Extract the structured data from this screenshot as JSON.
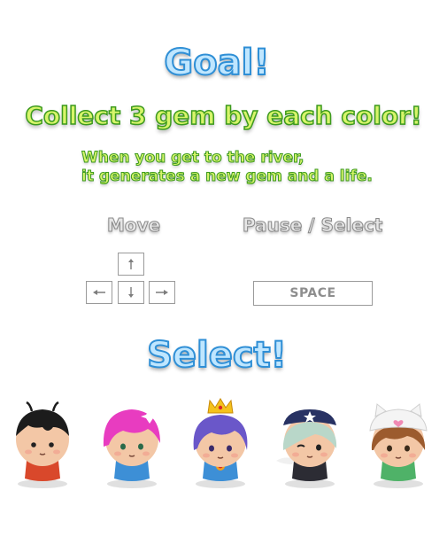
{
  "goal": {
    "title": "Goal!",
    "subtitle": "Collect 3 gem by each color!",
    "note_line1": "When you get to the river,",
    "note_line2": "it generates a new gem and a life."
  },
  "controls": {
    "move_label": "Move",
    "pause_label": "Pause / Select",
    "space_key": "SPACE",
    "arrow_icons": [
      "arrow-up-icon",
      "arrow-left-icon",
      "arrow-down-icon",
      "arrow-right-icon"
    ]
  },
  "select": {
    "title": "Select!",
    "characters": [
      {
        "name": "boy-character",
        "hair": "#1c1c1c",
        "shirt": "#d9482b"
      },
      {
        "name": "pink-hair-girl-character",
        "hair": "#e83cc0",
        "shirt": "#3d8fd6"
      },
      {
        "name": "princess-character",
        "hair": "#6a57c9",
        "shirt": "#3d8fd6"
      },
      {
        "name": "pirate-character",
        "hair": "#b9d7c9",
        "shirt": "#2c2c34"
      },
      {
        "name": "cat-hat-girl-character",
        "hair": "#9c5b2e",
        "shirt": "#4fb268"
      }
    ]
  }
}
